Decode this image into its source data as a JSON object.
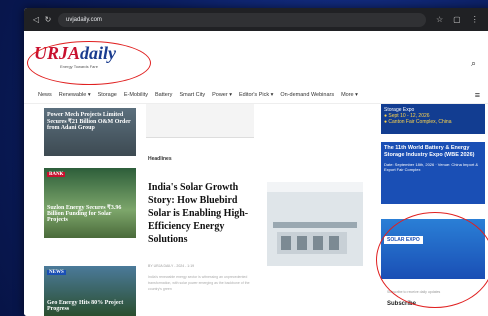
{
  "browser": {
    "url": "uvjadaily.com"
  },
  "header": {
    "logo_part1": "URJA",
    "logo_part2": "daily",
    "tagline": "Energy Towards Fare"
  },
  "nav": {
    "items": [
      "News",
      "Renewable ▾",
      "Storage",
      "E-Mobility",
      "Battery",
      "Smart City",
      "Power ▾",
      "Editor's Pick ▾",
      "On-demand Webinars",
      "More ▾"
    ]
  },
  "left_cards": [
    {
      "text": "Power Mech Projects Limited Secures ₹21 Billion O&M Order from Adani Group"
    },
    {
      "text": "Suzlon Energy Secures ₹3.96 Billion Funding for Solar Projects",
      "badge": "BANK"
    },
    {
      "text": "Geo Energy Hits 80% Project Progress",
      "badge": "NEWS"
    }
  ],
  "main": {
    "section_label": "Headlines",
    "article_title": "India's Solar Growth Story: How Bluebird Solar is Enabling High-Efficiency Energy Solutions",
    "meta": "BY URJA DAILY - 2024 - 1:19",
    "excerpt": "India's renewable energy sector is witnessing an unprecedented transformation, with solar power emerging as the backbone of the country's green"
  },
  "sidebar": {
    "ad1_lines": [
      "Storage Expo",
      "● Sept 10 - 12, 2026",
      "● Canton Fair Complex, China"
    ],
    "ad2_title": "The 11th World Battery & Energy Storage Industry Expo (WBE 2026)",
    "ad2_details": "Date: September 18th, 2026 · Venue: China Import & Export Fair Complex",
    "ad3_title": "SOLAR EXPO",
    "subscribe": "Subscribe",
    "subscribe_note": "Subscribe to receive daily updates"
  }
}
